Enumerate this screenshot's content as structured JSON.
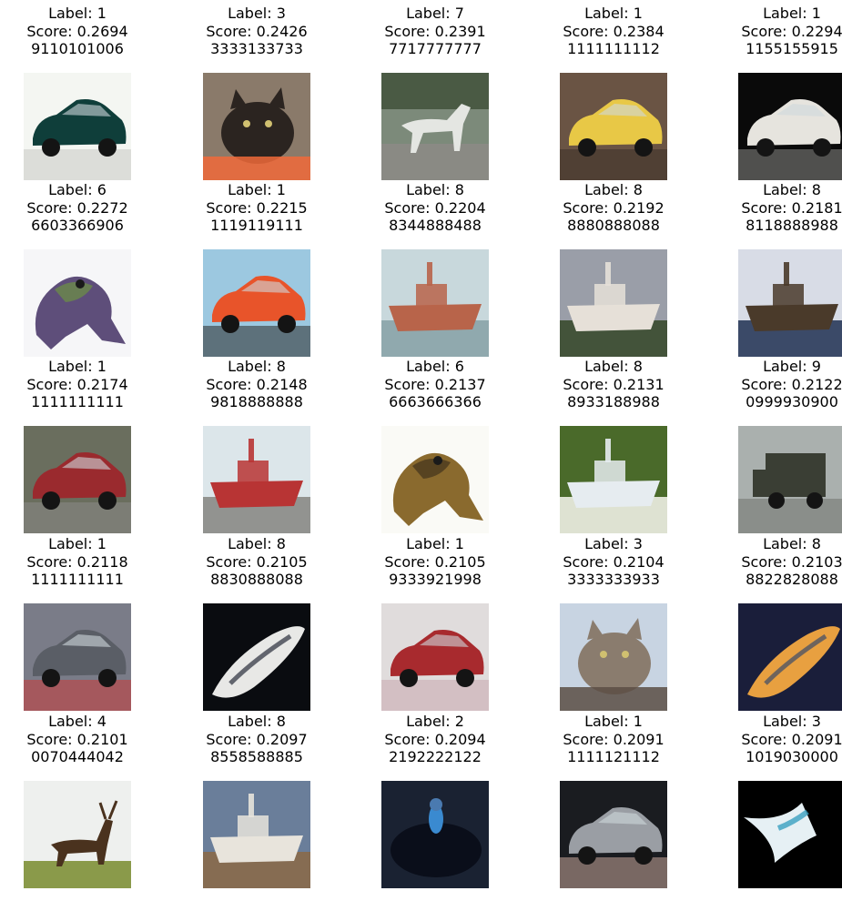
{
  "figure": {
    "items": [
      {
        "label": "Label: 1",
        "score": "Score: 0.2694",
        "digits": "9110101006",
        "subject": "car",
        "bg": "#f4f6f2",
        "fg": "#0f3e3a",
        "accent": "#c8c9c4"
      },
      {
        "label": "Label: 3",
        "score": "Score: 0.2426",
        "digits": "3333133733",
        "subject": "cat",
        "bg": "#8a7a6a",
        "fg": "#2b2420",
        "accent": "#f06a3a"
      },
      {
        "label": "Label: 7",
        "score": "Score: 0.2391",
        "digits": "7717777777",
        "subject": "horse",
        "bg": "#7c8a7a",
        "fg": "#e4e6e2",
        "accent": "#4a5a44"
      },
      {
        "label": "Label: 1",
        "score": "Score: 0.2384",
        "digits": "1111111112",
        "subject": "car",
        "bg": "#6a5444",
        "fg": "#e8c846",
        "accent": "#3a3028"
      },
      {
        "label": "Label: 1",
        "score": "Score: 0.2294",
        "digits": "1155155915",
        "subject": "car",
        "bg": "#0a0a0a",
        "fg": "#e6e4de",
        "accent": "#8a8a86"
      },
      {
        "label": "Label: 6",
        "score": "Score: 0.2272",
        "digits": "6603366906",
        "subject": "frog",
        "bg": "#f6f6f8",
        "fg": "#5e4e7a",
        "accent": "#6a8a4a"
      },
      {
        "label": "Label: 1",
        "score": "Score: 0.2215",
        "digits": "1119119111",
        "subject": "car",
        "bg": "#9cc8e0",
        "fg": "#e8542a",
        "accent": "#2a2a28"
      },
      {
        "label": "Label: 8",
        "score": "Score: 0.2204",
        "digits": "8344888488",
        "subject": "ship",
        "bg": "#c8d8dc",
        "fg": "#b8644a",
        "accent": "#8aa4a8"
      },
      {
        "label": "Label: 8",
        "score": "Score: 0.2192",
        "digits": "8880888088",
        "subject": "ship",
        "bg": "#9a9ea8",
        "fg": "#e6e0d8",
        "accent": "#3a4a2e"
      },
      {
        "label": "Label: 8",
        "score": "Score: 0.2181",
        "digits": "8118888988",
        "subject": "ship",
        "bg": "#d8dce6",
        "fg": "#4a3a2a",
        "accent": "#2a3a5a"
      },
      {
        "label": "Label: 1",
        "score": "Score: 0.2174",
        "digits": "1111111111",
        "subject": "car",
        "bg": "#6a6e5e",
        "fg": "#9a2a2e",
        "accent": "#8a8a88"
      },
      {
        "label": "Label: 8",
        "score": "Score: 0.2148",
        "digits": "9818888888",
        "subject": "ship",
        "bg": "#dce6ea",
        "fg": "#b83434",
        "accent": "#8a8a86"
      },
      {
        "label": "Label: 6",
        "score": "Score: 0.2137",
        "digits": "6663666366",
        "subject": "frog",
        "bg": "#fafaf6",
        "fg": "#8a6a2e",
        "accent": "#4a3a1e"
      },
      {
        "label": "Label: 8",
        "score": "Score: 0.2131",
        "digits": "8933188988",
        "subject": "ship",
        "bg": "#4a6a2a",
        "fg": "#e6ecf0",
        "accent": "#eef0e4"
      },
      {
        "label": "Label: 9",
        "score": "Score: 0.2122",
        "digits": "0999930900",
        "subject": "truck",
        "bg": "#aab0ae",
        "fg": "#3a3e34",
        "accent": "#7a7e7a"
      },
      {
        "label": "Label: 1",
        "score": "Score: 0.2118",
        "digits": "1111111111",
        "subject": "car",
        "bg": "#7a7c88",
        "fg": "#5a5e66",
        "accent": "#c83a3a"
      },
      {
        "label": "Label: 8",
        "score": "Score: 0.2105",
        "digits": "8830888088",
        "subject": "boat",
        "bg": "#0a0c10",
        "fg": "#e8e8e6",
        "accent": "#2a2e3a"
      },
      {
        "label": "Label: 1",
        "score": "Score: 0.2105",
        "digits": "9333921998",
        "subject": "car",
        "bg": "#e0dcdc",
        "fg": "#a82a2e",
        "accent": "#c8a8ae"
      },
      {
        "label": "Label: 3",
        "score": "Score: 0.2104",
        "digits": "3333333933",
        "subject": "cat",
        "bg": "#c8d4e2",
        "fg": "#8a7c6e",
        "accent": "#5a4e44"
      },
      {
        "label": "Label: 8",
        "score": "Score: 0.2103",
        "digits": "8822828088",
        "subject": "boat",
        "bg": "#1a1e3a",
        "fg": "#e8a040",
        "accent": "#3a4a6a"
      },
      {
        "label": "Label: 4",
        "score": "Score: 0.2101",
        "digits": "0070444042",
        "subject": "deer",
        "bg": "#eef0ee",
        "fg": "#4a321e",
        "accent": "#8a9a4a"
      },
      {
        "label": "Label: 8",
        "score": "Score: 0.2097",
        "digits": "8558588885",
        "subject": "ship",
        "bg": "#6a7e9a",
        "fg": "#e8e4dc",
        "accent": "#8a6a4a"
      },
      {
        "label": "Label: 2",
        "score": "Score: 0.2094",
        "digits": "2192222122",
        "subject": "bird",
        "bg": "#1a2232",
        "fg": "#0a0e1a",
        "accent": "#3a8ad0"
      },
      {
        "label": "Label: 1",
        "score": "Score: 0.2091",
        "digits": "1111121112",
        "subject": "car",
        "bg": "#1a1c20",
        "fg": "#9a9ea4",
        "accent": "#c8a89a"
      },
      {
        "label": "Label: 3",
        "score": "Score: 0.2091",
        "digits": "1019030000",
        "subject": "abstract",
        "bg": "#000000",
        "fg": "#e6f0f4",
        "accent": "#3aa0c0"
      }
    ]
  }
}
